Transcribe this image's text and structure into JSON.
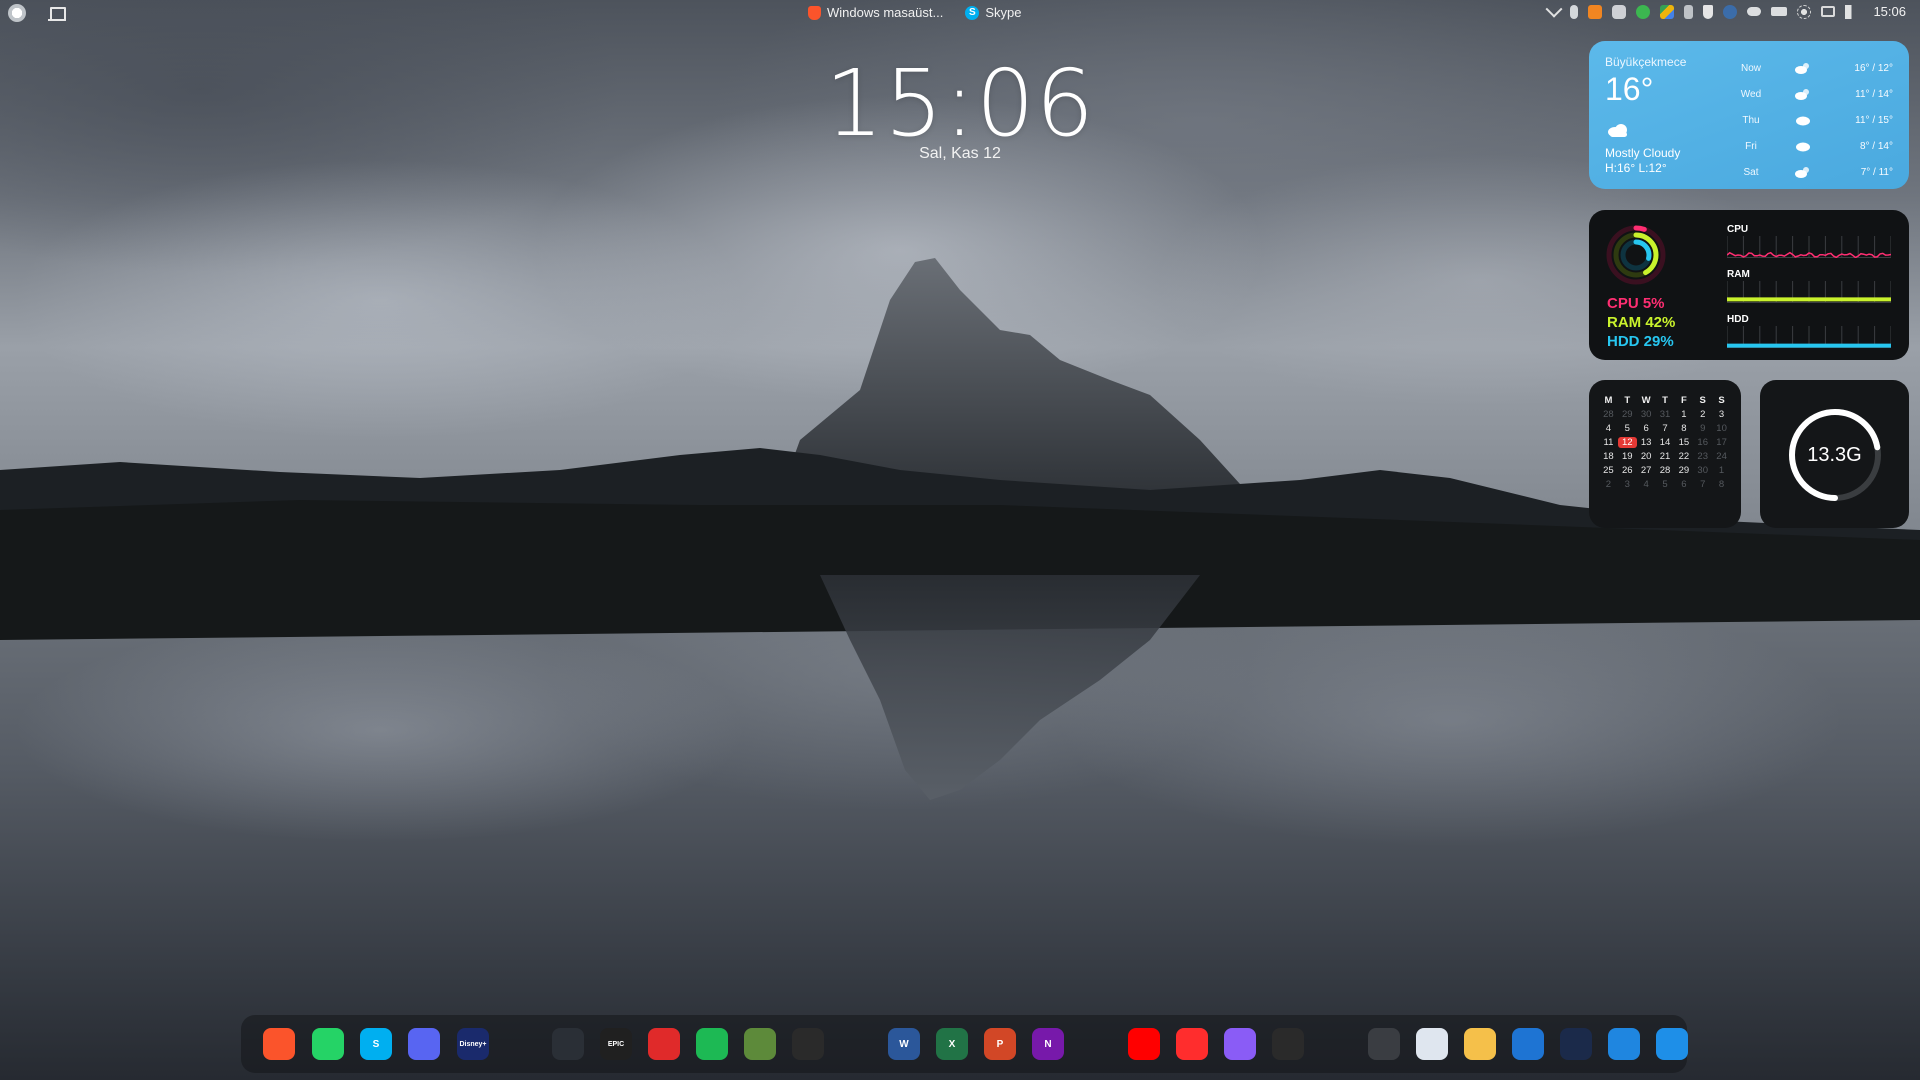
{
  "topbar": {
    "apps": [
      {
        "label": "Windows masaüst...",
        "icon": "brave-icon"
      },
      {
        "label": "Skype",
        "icon": "skype-icon"
      }
    ],
    "tray_icons": [
      "chevron-up-icon",
      "microphone-icon",
      "vlc-icon",
      "discord-icon",
      "check-icon",
      "google-drive-icon",
      "usb-icon",
      "security-icon",
      "steam-icon",
      "cloud-icon",
      "battery-icon",
      "brightness-icon",
      "network-icon",
      "volume-icon"
    ],
    "clock": "15:06"
  },
  "lockclock": {
    "time": "15:06",
    "date": "Sal, Kas 12"
  },
  "weather": {
    "city": "Büyükçekmece",
    "temp": "16°",
    "condition": "Mostly Cloudy",
    "hilo": "H:16° L:12°",
    "forecast": [
      {
        "day": "Now",
        "range": "16° / 12°"
      },
      {
        "day": "Wed",
        "range": "11° / 14°"
      },
      {
        "day": "Thu",
        "range": "11° / 15°"
      },
      {
        "day": "Fri",
        "range": "8° / 14°"
      },
      {
        "day": "Sat",
        "range": "7° / 11°"
      }
    ],
    "bg_color": "#4aa9df"
  },
  "system": {
    "cpu_text": "CPU 5%",
    "ram_text": "RAM 42%",
    "hdd_text": "HDD 29%",
    "cpu_pct": 5,
    "ram_pct": 42,
    "hdd_pct": 29,
    "graph_labels": {
      "cpu": "CPU",
      "ram": "RAM",
      "hdd": "HDD"
    },
    "colors": {
      "cpu": "#ff2e72",
      "ram": "#c9f22c",
      "hdd": "#27c6f0"
    }
  },
  "calendar": {
    "headers": [
      "M",
      "T",
      "W",
      "T",
      "F",
      "S",
      "S"
    ],
    "days": [
      [
        "28",
        "29",
        "30",
        "31",
        "1",
        "2",
        "3"
      ],
      [
        "4",
        "5",
        "6",
        "7",
        "8",
        "9",
        "10"
      ],
      [
        "11",
        "12",
        "13",
        "14",
        "15",
        "16",
        "17"
      ],
      [
        "18",
        "19",
        "20",
        "21",
        "22",
        "23",
        "24"
      ],
      [
        "25",
        "26",
        "27",
        "28",
        "29",
        "30",
        "1"
      ],
      [
        "2",
        "3",
        "4",
        "5",
        "6",
        "7",
        "8"
      ]
    ],
    "today": "12"
  },
  "storage": {
    "value": "13.3G",
    "fill_fraction": 0.72
  },
  "dock": {
    "apps": [
      {
        "name": "brave-icon",
        "glyph": "",
        "color": "#fb542b"
      },
      {
        "name": "whatsapp-icon",
        "glyph": "",
        "color": "#25d366"
      },
      {
        "name": "skype-icon",
        "glyph": "S",
        "color": "#00aff0"
      },
      {
        "name": "discord-icon",
        "glyph": "",
        "color": "#5865f2"
      },
      {
        "name": "disney-plus-icon",
        "glyph": "Disney+",
        "color": "#1a2a6c"
      },
      {
        "name": "steam-icon",
        "glyph": "",
        "color": "#2a2f36"
      },
      {
        "name": "epic-games-icon",
        "glyph": "EPIC",
        "color": "#202020"
      },
      {
        "name": "fist-app-icon",
        "glyph": "",
        "color": "#e02a2a"
      },
      {
        "name": "xbox-icon",
        "glyph": "",
        "color": "#1db954"
      },
      {
        "name": "minecraft-icon",
        "glyph": "",
        "color": "#5d8a3a"
      },
      {
        "name": "app-grid-icon",
        "glyph": "",
        "color": "#2a2a2a"
      },
      {
        "name": "word-icon",
        "glyph": "W",
        "color": "#2b579a"
      },
      {
        "name": "excel-icon",
        "glyph": "X",
        "color": "#217346"
      },
      {
        "name": "powerpoint-icon",
        "glyph": "P",
        "color": "#d24726"
      },
      {
        "name": "onenote-icon",
        "glyph": "N",
        "color": "#7719aa"
      },
      {
        "name": "youtube-icon",
        "glyph": "",
        "color": "#ff0000"
      },
      {
        "name": "youtube-music-icon",
        "glyph": "",
        "color": "#ff2d2d"
      },
      {
        "name": "copilot-icon",
        "glyph": "",
        "color": "#8a5cf6"
      },
      {
        "name": "google-drive-icon",
        "glyph": "",
        "color": "#2a2a2a"
      },
      {
        "name": "settings-icon",
        "glyph": "",
        "color": "#3a3d42"
      },
      {
        "name": "control-panel-icon",
        "glyph": "",
        "color": "#dfe6ef"
      },
      {
        "name": "file-explorer-icon",
        "glyph": "",
        "color": "#f5c04a"
      },
      {
        "name": "microsoft-store-icon",
        "glyph": "",
        "color": "#1e74d3"
      },
      {
        "name": "affinity-icon",
        "glyph": "",
        "color": "#1b2a4a"
      },
      {
        "name": "wifi-radar-icon",
        "glyph": "",
        "color": "#1f86e0"
      },
      {
        "name": "split-view-icon",
        "glyph": "",
        "color": "#1e8fe8"
      }
    ]
  }
}
